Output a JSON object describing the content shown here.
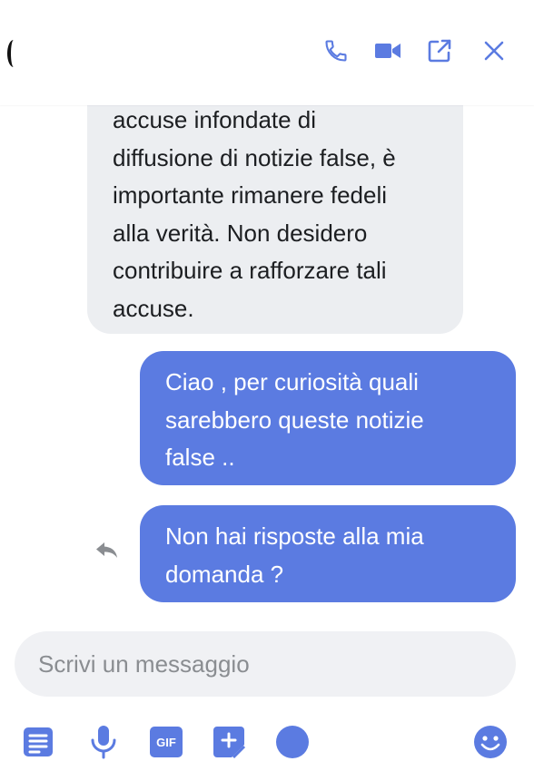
{
  "colors": {
    "accent": "#5b7be1",
    "incoming_bubble": "#eceef1",
    "composer_bg": "#f0f1f4"
  },
  "header": {
    "icons": [
      "phone-icon",
      "video-camera-icon",
      "pop-out-icon",
      "close-icon"
    ]
  },
  "messages": [
    {
      "direction": "incoming",
      "lines": [
        "accuse infondate di",
        "diffusione di notizie false, è",
        "importante rimanere fedeli",
        "alla verità. Non desidero",
        "contribuire a rafforzare tali",
        "accuse."
      ]
    },
    {
      "direction": "outgoing",
      "lines": [
        "Ciao , per curiosità quali",
        "sarebbero queste notizie",
        "false .."
      ]
    },
    {
      "direction": "outgoing",
      "lines": [
        "Non hai risposte alla mia",
        "domanda ?"
      ]
    }
  ],
  "composer": {
    "placeholder": "Scrivi un messaggio",
    "value": ""
  },
  "toolbar": {
    "icons": [
      "document-icon",
      "microphone-icon",
      "gif-icon",
      "sticker-icon",
      "color-dot-icon",
      "emoji-icon"
    ],
    "gif_label": "GIF"
  }
}
